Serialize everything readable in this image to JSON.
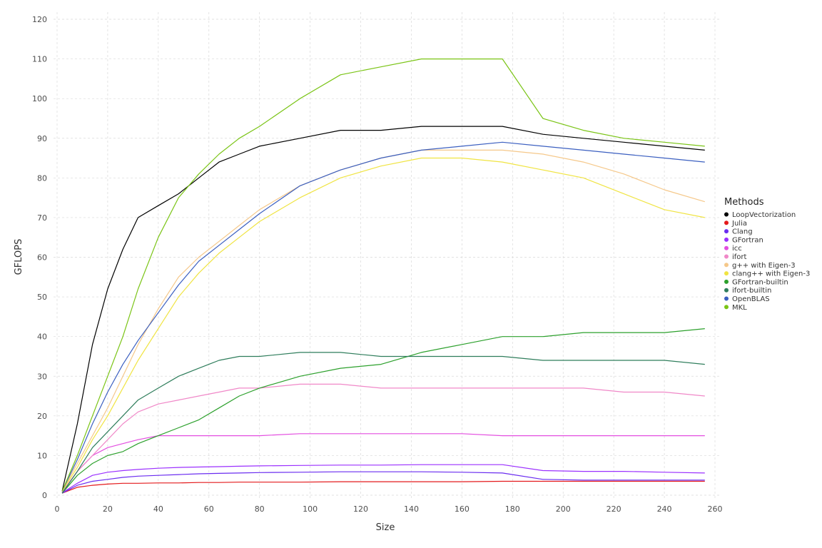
{
  "chart_data": {
    "type": "line",
    "xlabel": "Size",
    "ylabel": "GFLOPS",
    "xlim": [
      0,
      260
    ],
    "ylim": [
      0,
      120
    ],
    "x_ticks": [
      0,
      20,
      40,
      60,
      80,
      100,
      120,
      140,
      160,
      180,
      200,
      220,
      240,
      260
    ],
    "y_ticks": [
      0,
      10,
      20,
      30,
      40,
      50,
      60,
      70,
      80,
      90,
      100,
      110,
      120
    ],
    "grid": true,
    "legend_title": "Methods",
    "legend_position": "right",
    "x": [
      2,
      8,
      14,
      20,
      26,
      32,
      40,
      48,
      56,
      64,
      72,
      80,
      96,
      112,
      128,
      144,
      160,
      176,
      192,
      208,
      224,
      240,
      256
    ],
    "series": [
      {
        "name": "LoopVectorization",
        "color": "#000000",
        "values": [
          1,
          18,
          38,
          52,
          62,
          70,
          73,
          76,
          80,
          84,
          86,
          88,
          90,
          92,
          92,
          93,
          93,
          93,
          91,
          90,
          89,
          88,
          87
        ]
      },
      {
        "name": "Julia",
        "color": "#e41a1c",
        "values": [
          0.5,
          2,
          2.5,
          2.8,
          3,
          3,
          3.1,
          3.1,
          3.2,
          3.2,
          3.3,
          3.3,
          3.3,
          3.4,
          3.4,
          3.4,
          3.4,
          3.5,
          3.5,
          3.5,
          3.5,
          3.5,
          3.5
        ]
      },
      {
        "name": "Clang",
        "color": "#6a2cf0",
        "values": [
          0.5,
          2.5,
          3.5,
          4,
          4.5,
          4.8,
          5,
          5.2,
          5.4,
          5.5,
          5.6,
          5.7,
          5.8,
          5.9,
          5.9,
          5.9,
          5.8,
          5.6,
          4,
          3.8,
          3.8,
          3.8,
          3.8
        ]
      },
      {
        "name": "GFortran",
        "color": "#9b30ff",
        "values": [
          0.6,
          3,
          5,
          5.8,
          6.2,
          6.5,
          6.8,
          7,
          7.1,
          7.2,
          7.3,
          7.4,
          7.5,
          7.6,
          7.6,
          7.7,
          7.7,
          7.7,
          6.2,
          6,
          6,
          5.8,
          5.6
        ]
      },
      {
        "name": "icc",
        "color": "#e34fe0",
        "values": [
          0.8,
          6,
          10,
          12,
          13,
          14,
          15,
          15,
          15,
          15,
          15,
          15,
          15.5,
          15.5,
          15.5,
          15.5,
          15.5,
          15,
          15,
          15,
          15,
          15,
          15
        ]
      },
      {
        "name": "ifort",
        "color": "#f088c8",
        "values": [
          0.8,
          6,
          10,
          14,
          18,
          21,
          23,
          24,
          25,
          26,
          27,
          27,
          28,
          28,
          27,
          27,
          27,
          27,
          27,
          27,
          26,
          26,
          25
        ]
      },
      {
        "name": "g++ with Eigen-3",
        "color": "#f5c88a",
        "values": [
          1,
          8,
          15,
          22,
          30,
          38,
          47,
          55,
          60,
          64,
          68,
          72,
          78,
          82,
          85,
          87,
          87,
          87,
          86,
          84,
          81,
          77,
          74
        ]
      },
      {
        "name": "clang++ with Eigen-3",
        "color": "#f0e442",
        "values": [
          1,
          7,
          14,
          20,
          27,
          34,
          42,
          50,
          56,
          61,
          65,
          69,
          75,
          80,
          83,
          85,
          85,
          84,
          82,
          80,
          76,
          72,
          70
        ]
      },
      {
        "name": "GFortran-builtin",
        "color": "#2ca02c",
        "values": [
          0.5,
          5,
          8,
          10,
          11,
          13,
          15,
          17,
          19,
          22,
          25,
          27,
          30,
          32,
          33,
          36,
          38,
          40,
          40,
          41,
          41,
          41,
          42
        ]
      },
      {
        "name": "ifort-builtin",
        "color": "#2e7d5b",
        "values": [
          0.5,
          6,
          12,
          16,
          20,
          24,
          27,
          30,
          32,
          34,
          35,
          35,
          36,
          36,
          35,
          35,
          35,
          35,
          34,
          34,
          34,
          34,
          33
        ]
      },
      {
        "name": "OpenBLAS",
        "color": "#3b5fc0",
        "values": [
          1,
          9,
          18,
          26,
          33,
          39,
          46,
          53,
          59,
          63,
          67,
          71,
          78,
          82,
          85,
          87,
          88,
          89,
          88,
          87,
          86,
          85,
          84
        ]
      },
      {
        "name": "MKL",
        "color": "#7ac415",
        "values": [
          1,
          10,
          20,
          30,
          40,
          52,
          65,
          75,
          81,
          86,
          90,
          93,
          100,
          106,
          108,
          110,
          110,
          110,
          95,
          92,
          90,
          89,
          88
        ]
      }
    ]
  }
}
